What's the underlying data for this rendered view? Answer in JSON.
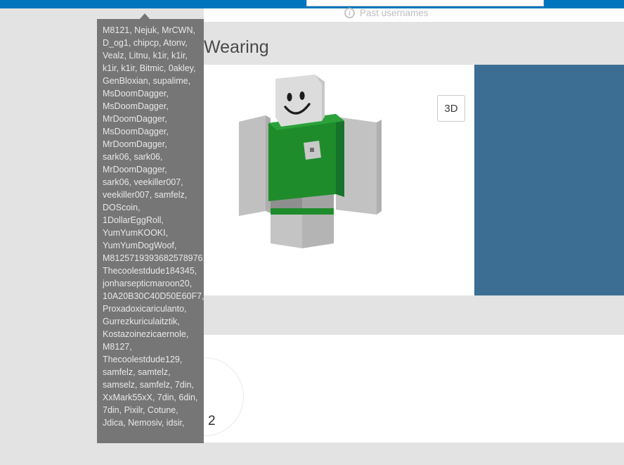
{
  "topbar": {
    "background_color": "#0074bd",
    "search": {
      "value": "",
      "placeholder": ""
    }
  },
  "header": {
    "info_icon_glyph": "i",
    "past_usernames_label": "Past usernames"
  },
  "main": {
    "section_title": "Wearing",
    "view_3d_button": "3D",
    "blue_panel_color": "#3c6e93",
    "count_badge": "2"
  },
  "tooltip": {
    "background_color": "#767676",
    "text_color": "#e8e8e8",
    "content": "M8121, Nejuk, MrCWN, D_og1, chipcp, Atonv, Vealz, Litnu, k1ir, k1ir, k1ir, k1ir, Bitmic, 0akley, GenBloxian, supalime, MsDoomDagger, MsDoomDagger, MrDoomDagger, MsDoomDagger, MrDoomDagger, sark06, sark06, MrDoomDagger, sark06, veekiller007, veekiller007, samfelz, DOScoin, 1DollarEggRoll, YumYumKOOKI, YumYumDogWoof, M8125719393682578976, Thecoolestdude184345, jonharsepticmaroon20, 10A20B30C40D50E60F7, Proxadoxicariculanto, Gurrezkuriculaitztik, Kostazoinezicaernole, M8127, Thecoolestdude129, samfelz, samtelz, samselz, samfelz, 7din, XxMark55xX, 7din, 6din, 7din, Pixilr, Cotune, Jdica, Nemosiv, idsir,"
  },
  "avatar": {
    "description": "blocky humanoid avatar",
    "shirt_color": "#218c2e",
    "body_color": "#b8b8b8",
    "head_color": "#d6d6d6"
  }
}
